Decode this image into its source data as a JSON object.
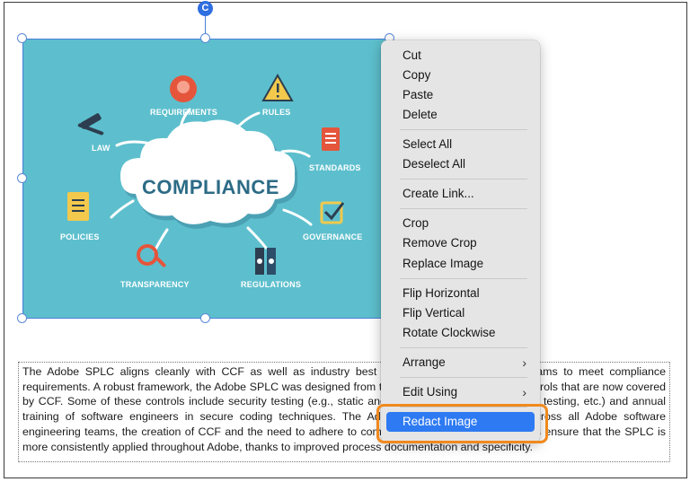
{
  "image": {
    "title": "COMPLIANCE",
    "labels": {
      "requirements": "REQUIREMENTS",
      "rules": "RULES",
      "law": "LAW",
      "standards": "STANDARDS",
      "policies": "POLICIES",
      "governance": "GOVERNANCE",
      "transparency": "TRANSPARENCY",
      "regulations": "REGULATIONS"
    },
    "rotate_glyph": "C"
  },
  "text_body": "The Adobe SPLC aligns cleanly with CCF as well as industry best practices, enabling product teams to meet compliance requirements. A robust framework, the Adobe SPLC was designed from the ground up so that many controls that are now covered by CCF. Some of these controls include security testing (e.g., static and dynamic analysis, penetration testing, etc.) and annual training of software engineers in secure coding techniques. The Adobe SPLC is broadly used across all Adobe software engineering teams, the creation of CCF and the need to adhere to compliance requirements now helps ensure that the SPLC is more consistently applied throughout Adobe, thanks to improved process documentation and specificity.",
  "context_menu": {
    "items": [
      {
        "label": "Cut"
      },
      {
        "label": "Copy"
      },
      {
        "label": "Paste"
      },
      {
        "label": "Delete"
      },
      {
        "label": "Select All"
      },
      {
        "label": "Deselect All"
      },
      {
        "label": "Create Link..."
      },
      {
        "label": "Crop"
      },
      {
        "label": "Remove Crop"
      },
      {
        "label": "Replace Image"
      },
      {
        "label": "Flip Horizontal"
      },
      {
        "label": "Flip Vertical"
      },
      {
        "label": "Rotate Clockwise"
      },
      {
        "label": "Arrange",
        "arrow": "›"
      },
      {
        "label": "Edit Using",
        "arrow": "›"
      },
      {
        "label": "Redact Image"
      }
    ]
  },
  "colors": {
    "image_bg": "#5dbfcd",
    "menu_highlight": "#2e7af2",
    "callout_border": "#f0891d",
    "selection": "#4a7fd8"
  }
}
